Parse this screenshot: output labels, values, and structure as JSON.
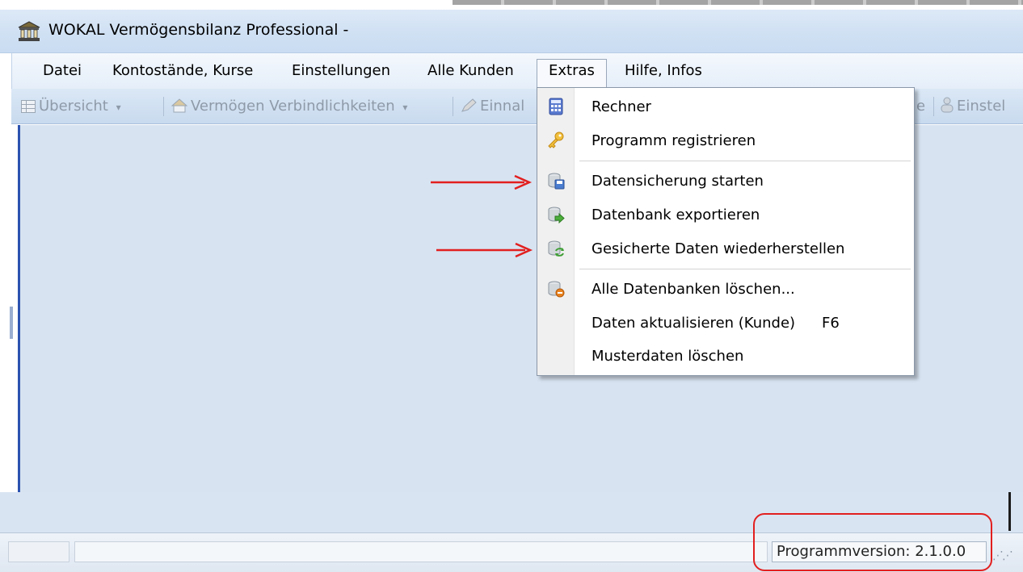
{
  "window": {
    "title": "WOKAL Vermögensbilanz Professional  -"
  },
  "menubar": {
    "items": [
      "Datei",
      "Kontostände, Kurse",
      "Einstellungen",
      "Alle Kunden",
      "Extras",
      "Hilfe, Infos"
    ]
  },
  "toolbar": {
    "overview": "Übersicht",
    "assets": "Vermögen Verbindlichkeiten",
    "income": "Einnal",
    "e_fragment": "e",
    "settings": "Einstel"
  },
  "extras_menu": {
    "items": [
      {
        "label": "Rechner",
        "icon": "calculator-icon"
      },
      {
        "label": "Programm registrieren",
        "icon": "key-icon"
      },
      {
        "label": "Datensicherung starten",
        "icon": "database-save-icon"
      },
      {
        "label": "Datenbank exportieren",
        "icon": "database-export-icon"
      },
      {
        "label": "Gesicherte Daten wiederherstellen",
        "icon": "database-restore-icon"
      },
      {
        "label": "Alle Datenbanken löschen...",
        "icon": "database-delete-icon"
      },
      {
        "label": "Daten aktualisieren (Kunde)",
        "shortcut": "F6"
      },
      {
        "label": "Musterdaten löschen"
      }
    ]
  },
  "statusbar": {
    "version": "Programmversion: 2.1.0.0"
  },
  "colors": {
    "annotation_red": "#e21f1f",
    "workspace": "#d7e3f1",
    "accent_blue": "#2b52b0"
  }
}
